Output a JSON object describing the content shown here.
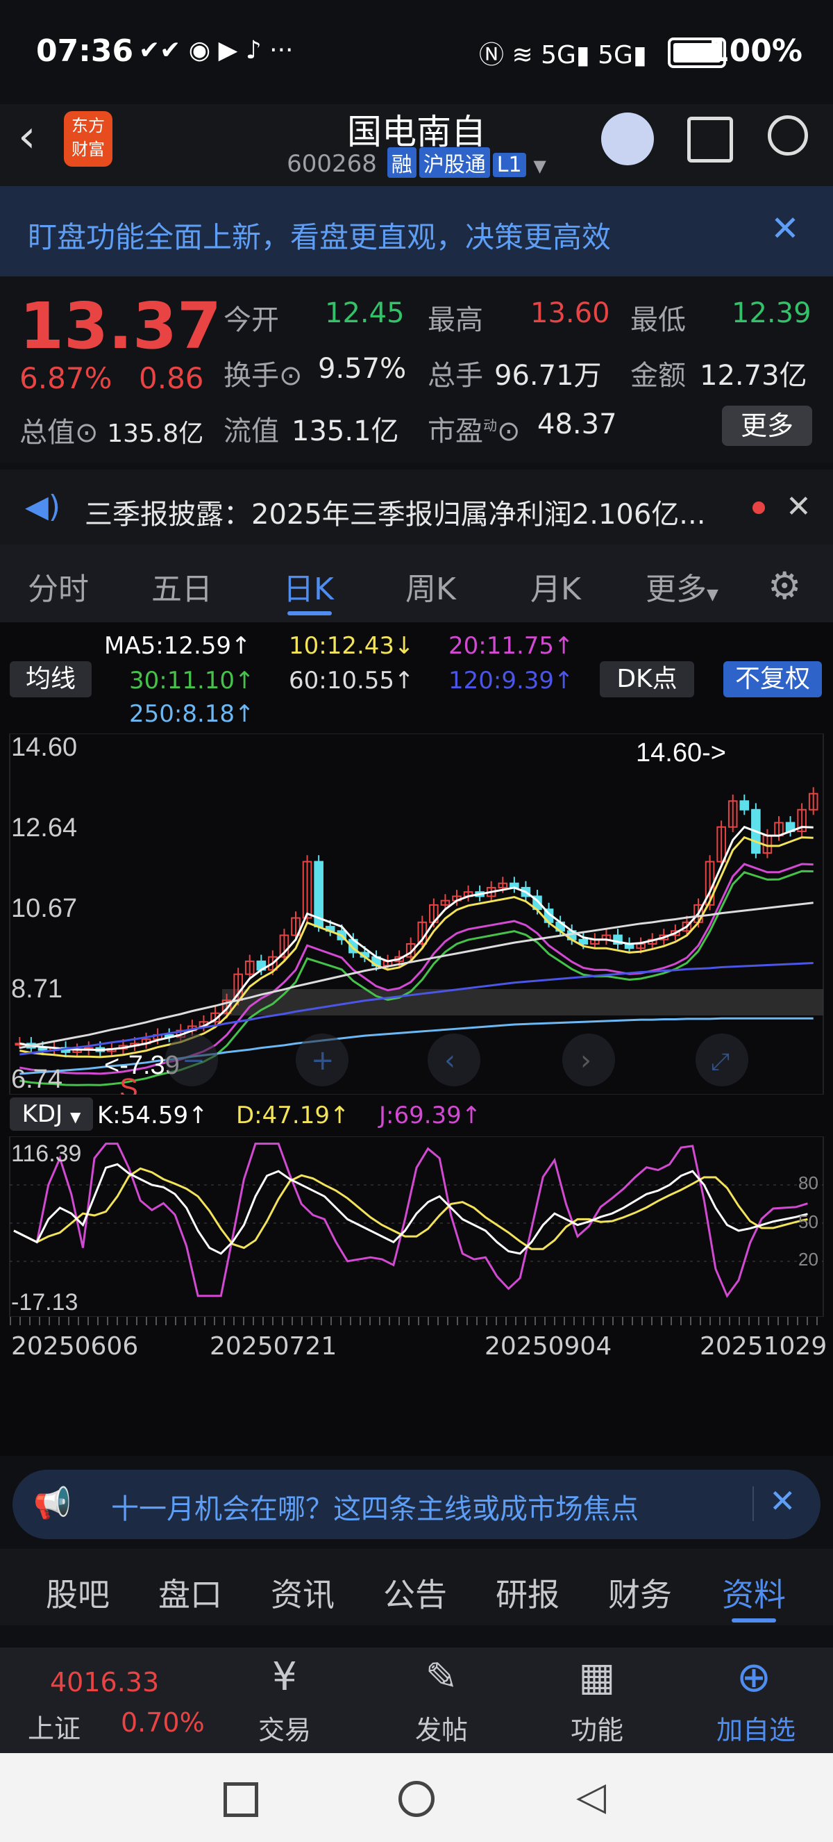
{
  "status": {
    "time": "07:36",
    "battery": "100%",
    "signal": "5G"
  },
  "header": {
    "name": "国电南自",
    "code": "600268",
    "tags": [
      "融",
      "沪股通",
      "L1"
    ],
    "logo": "东方财富"
  },
  "banner": {
    "text": "盯盘功能全面上新，看盘更直观，决策更高效"
  },
  "quote": {
    "price": "13.37",
    "pct": "6.87%",
    "chg": "0.86",
    "open_l": "今开",
    "open": "12.45",
    "high_l": "最高",
    "high": "13.60",
    "low_l": "最低",
    "low": "12.39",
    "turn_l": "换手",
    "turn": "9.57%",
    "vol_l": "总手",
    "vol": "96.71万",
    "amt_l": "金额",
    "amt": "12.73亿",
    "mcap_l": "总值",
    "mcap": "135.8亿",
    "fcap_l": "流值",
    "fcap": "135.1亿",
    "pe_l": "市盈",
    "pe_sup": "动",
    "pe": "48.37",
    "more": "更多"
  },
  "news": {
    "text": "三季报披露：2025年三季报归属净利润2.106亿..."
  },
  "ktabs": [
    "分时",
    "五日",
    "日K",
    "周K",
    "月K",
    "更多"
  ],
  "ma": {
    "btn": "均线",
    "dk": "DK点",
    "fq": "不复权",
    "ma5": "MA5:12.59↑",
    "ma10": "10:12.43↓",
    "ma20": "20:11.75↑",
    "ma30": "30:11.10↑",
    "ma60": "60:10.55↑",
    "ma120": "120:9.39↑",
    "ma250": "250:8.18↑"
  },
  "kdj": {
    "btn": "KDJ",
    "k": "K:54.59↑",
    "d": "D:47.19↑",
    "j": "J:69.39↑",
    "top": "116.39",
    "bottom": "-17.13",
    "r80": "80",
    "r50": "50",
    "r20": "20"
  },
  "chart_data": {
    "type": "line",
    "y_ticks": [
      "14.60",
      "12.64",
      "10.67",
      "8.71",
      "6.74"
    ],
    "x_ticks": [
      "20250606",
      "20250721",
      "20250904",
      "20251029"
    ],
    "max_label": "14.60->",
    "min_label": "<-7.39",
    "s_label": "S",
    "ylim": [
      6.74,
      14.6
    ],
    "close": [
      7.6,
      7.5,
      7.45,
      7.5,
      7.4,
      7.45,
      7.5,
      7.42,
      7.48,
      7.55,
      7.6,
      7.7,
      7.8,
      7.75,
      7.9,
      8.0,
      8.1,
      8.3,
      8.6,
      9.2,
      9.5,
      9.3,
      9.6,
      10.1,
      10.5,
      11.8,
      10.3,
      10.2,
      10.0,
      9.7,
      9.6,
      9.4,
      9.5,
      9.6,
      9.9,
      10.4,
      10.8,
      10.9,
      11.0,
      11.1,
      11.0,
      11.2,
      11.3,
      11.2,
      11.0,
      10.7,
      10.4,
      10.2,
      10.0,
      9.9,
      10.0,
      10.1,
      9.9,
      9.8,
      9.9,
      10.0,
      10.1,
      10.2,
      10.4,
      10.8,
      11.8,
      12.6,
      13.2,
      13.0,
      12.0,
      12.4,
      12.7,
      12.5,
      13.0,
      13.37
    ],
    "ma5": [
      7.6,
      7.55,
      7.52,
      7.5,
      7.47,
      7.46,
      7.46,
      7.45,
      7.47,
      7.5,
      7.55,
      7.6,
      7.68,
      7.74,
      7.8,
      7.9,
      8.0,
      8.15,
      8.4,
      8.75,
      9.1,
      9.3,
      9.45,
      9.7,
      10.0,
      10.6,
      10.5,
      10.4,
      10.3,
      10.0,
      9.8,
      9.6,
      9.5,
      9.55,
      9.7,
      10.0,
      10.4,
      10.7,
      10.9,
      11.0,
      11.05,
      11.1,
      11.15,
      11.2,
      11.1,
      10.9,
      10.6,
      10.4,
      10.2,
      10.05,
      10.0,
      10.0,
      9.95,
      9.9,
      9.92,
      9.98,
      10.05,
      10.15,
      10.3,
      10.6,
      11.1,
      11.7,
      12.3,
      12.6,
      12.5,
      12.4,
      12.4,
      12.5,
      12.6,
      12.59
    ],
    "ma250": [
      6.9,
      6.92,
      6.94,
      6.96,
      6.98,
      7.0,
      7.02,
      7.05,
      7.08,
      7.1,
      7.13,
      7.16,
      7.2,
      7.23,
      7.26,
      7.3,
      7.33,
      7.36,
      7.4,
      7.43,
      7.46,
      7.5,
      7.53,
      7.56,
      7.6,
      7.63,
      7.66,
      7.69,
      7.72,
      7.75,
      7.78,
      7.8,
      7.82,
      7.84,
      7.86,
      7.88,
      7.9,
      7.92,
      7.94,
      7.96,
      7.98,
      8.0,
      8.02,
      8.04,
      8.05,
      8.06,
      8.07,
      8.08,
      8.09,
      8.1,
      8.11,
      8.12,
      8.13,
      8.14,
      8.15,
      8.15,
      8.16,
      8.16,
      8.17,
      8.17,
      8.17,
      8.18,
      8.18,
      8.18,
      8.18,
      8.18,
      8.18,
      8.18,
      8.18,
      8.18
    ]
  },
  "ad": {
    "text": "十一月机会在哪？这四条主线或成市场焦点"
  },
  "btabs": [
    "股吧",
    "盘口",
    "资讯",
    "公告",
    "研报",
    "财务",
    "资料"
  ],
  "toolbar": {
    "idx_name": "上证",
    "idx_val": "4016.33",
    "idx_pct": "0.70%",
    "items": [
      "交易",
      "发帖",
      "功能",
      "加自选"
    ]
  },
  "colors": {
    "up": "#e84444",
    "down": "#33c26a",
    "accent": "#4f8ef0",
    "ma5": "#ffffff",
    "ma10": "#f2e35b",
    "ma20": "#d24ad2",
    "ma30": "#46c24a",
    "ma60": "#dcdcdc",
    "ma120": "#4b55e6",
    "ma250": "#6cb8f4"
  }
}
